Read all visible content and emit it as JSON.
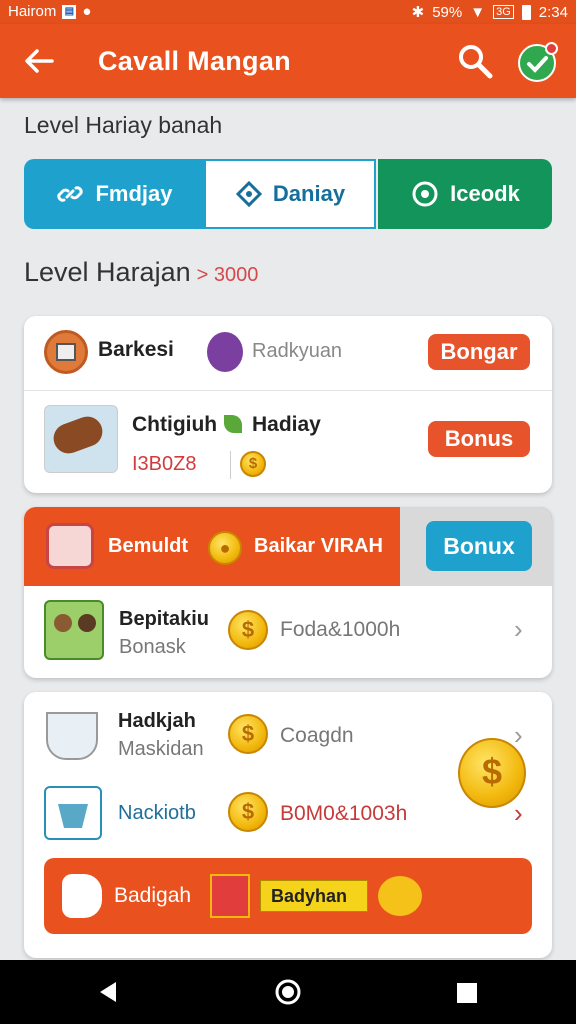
{
  "status_bar": {
    "carrier": "Hairom",
    "battery": "59%",
    "clock": "2:34",
    "badge": "3G"
  },
  "app_bar": {
    "title": "Cavall Mangan"
  },
  "level_title": "Level Hariay banah",
  "tabs": [
    {
      "label": "Fmdjay",
      "icon": "link-icon"
    },
    {
      "label": "Daniay",
      "icon": "diamond-icon"
    },
    {
      "label": "Iceodk",
      "icon": "target-icon"
    }
  ],
  "section": {
    "title": "Level Harajan",
    "accent": "> 3000"
  },
  "card1": {
    "row1": {
      "name": "Barkesi",
      "sub": "Radkyuan",
      "button": "Bongar"
    },
    "row2": {
      "name": "Chtigiuh",
      "name2": "Hadiay",
      "value": "I3B0Z8",
      "button": "Bonus"
    }
  },
  "card2": {
    "header": {
      "left": "Bemuldt",
      "right": "Baikar VIRAH",
      "button": "Bonux"
    },
    "row": {
      "name": "Bepitakiu",
      "sub": "Bonask",
      "value": "Foda&1000h"
    }
  },
  "card3": {
    "row1": {
      "name": "Hadkjah",
      "sub": "Maskidan",
      "value": "Coagdn"
    },
    "row2": {
      "name": "Nackiotb",
      "value": "B0M0&1003h"
    },
    "banner": {
      "left": "Badigah",
      "mid": "Badyhan"
    }
  },
  "colors": {
    "brand": "#e9521e",
    "blue": "#1ea1cc",
    "green": "#13945b",
    "coin": "#f2b80d"
  }
}
